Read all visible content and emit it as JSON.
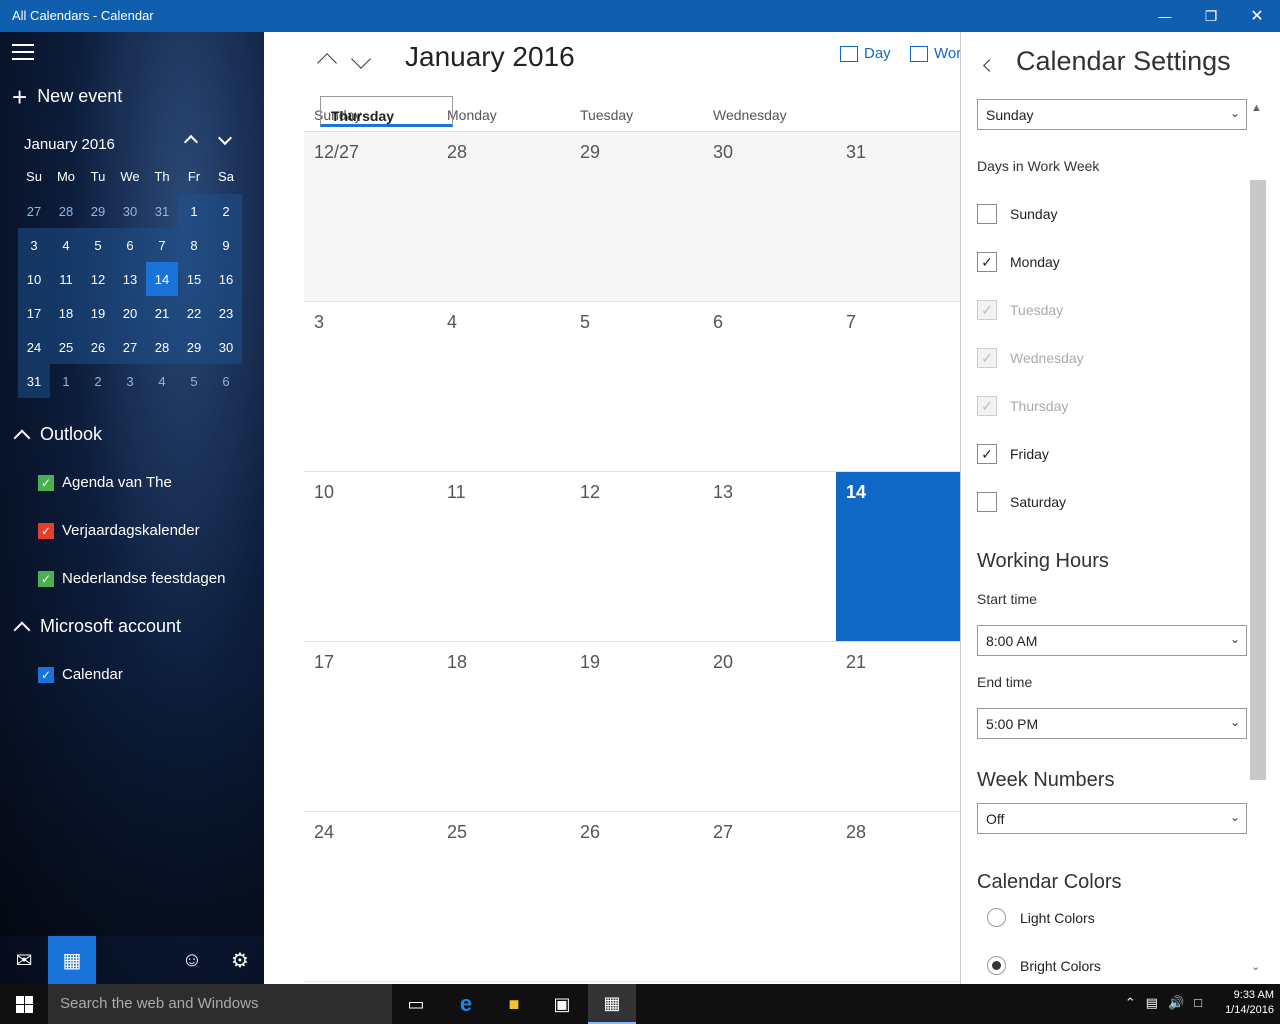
{
  "window": {
    "title": "All Calendars - Calendar",
    "minimize_icon": "minimize-icon",
    "restore_icon": "restore-icon",
    "close_icon": "close-icon"
  },
  "sidebar": {
    "new_event": "New event",
    "mini_month": "January 2016",
    "weekday_abbr": [
      "Su",
      "Mo",
      "Tu",
      "We",
      "Th",
      "Fr",
      "Sa"
    ],
    "weeks": [
      [
        "27",
        "28",
        "29",
        "30",
        "31",
        "1",
        "2"
      ],
      [
        "3",
        "4",
        "5",
        "6",
        "7",
        "8",
        "9"
      ],
      [
        "10",
        "11",
        "12",
        "13",
        "14",
        "15",
        "16"
      ],
      [
        "17",
        "18",
        "19",
        "20",
        "21",
        "22",
        "23"
      ],
      [
        "24",
        "25",
        "26",
        "27",
        "28",
        "29",
        "30"
      ],
      [
        "31",
        "1",
        "2",
        "3",
        "4",
        "5",
        "6"
      ]
    ],
    "groups": [
      {
        "name": "Outlook",
        "items": [
          {
            "label": "Agenda van The",
            "color": "#4caf50",
            "checked": true
          },
          {
            "label": "Verjaardagskalender",
            "color": "#e2402f",
            "checked": true
          },
          {
            "label": "Nederlandse feestdagen",
            "color": "#4caf50",
            "checked": true
          }
        ]
      },
      {
        "name": "Microsoft account",
        "items": [
          {
            "label": "Calendar",
            "color": "#1a73d9",
            "checked": true
          }
        ]
      }
    ]
  },
  "main": {
    "month_title": "January 2016",
    "view_day": "Day",
    "view_workweek": "Wor",
    "weekdays": [
      "Sunday",
      "Monday",
      "Tuesday",
      "Wednesday",
      "Thursday"
    ],
    "selected_weekday": "Thursday",
    "weeks": [
      [
        "12/27",
        "28",
        "29",
        "30",
        "31"
      ],
      [
        "3",
        "4",
        "5",
        "6",
        "7"
      ],
      [
        "10",
        "11",
        "12",
        "13",
        "14"
      ],
      [
        "17",
        "18",
        "19",
        "20",
        "21"
      ],
      [
        "24",
        "25",
        "26",
        "27",
        "28"
      ]
    ],
    "today": "14"
  },
  "settings": {
    "title": "Calendar Settings",
    "first_day_value": "Sunday",
    "work_week_label": "Days in Work Week",
    "work_days": [
      {
        "label": "Sunday",
        "checked": false,
        "disabled": false
      },
      {
        "label": "Monday",
        "checked": true,
        "disabled": false
      },
      {
        "label": "Tuesday",
        "checked": true,
        "disabled": true
      },
      {
        "label": "Wednesday",
        "checked": true,
        "disabled": true
      },
      {
        "label": "Thursday",
        "checked": true,
        "disabled": true
      },
      {
        "label": "Friday",
        "checked": true,
        "disabled": false
      },
      {
        "label": "Saturday",
        "checked": false,
        "disabled": false
      }
    ],
    "working_hours_heading": "Working Hours",
    "start_time_label": "Start time",
    "start_time_value": "8:00 AM",
    "end_time_label": "End time",
    "end_time_value": "5:00 PM",
    "week_numbers_heading": "Week Numbers",
    "week_numbers_value": "Off",
    "calendar_colors_heading": "Calendar Colors",
    "color_options": [
      {
        "label": "Light Colors",
        "selected": false
      },
      {
        "label": "Bright Colors",
        "selected": true
      }
    ]
  },
  "taskbar": {
    "search_placeholder": "Search the web and Windows",
    "time": "9:33 AM",
    "date": "1/14/2016"
  },
  "colors": {
    "accent": "#1a73d9",
    "titlebar": "#0f5fae",
    "today_cell": "#0f67c6"
  }
}
